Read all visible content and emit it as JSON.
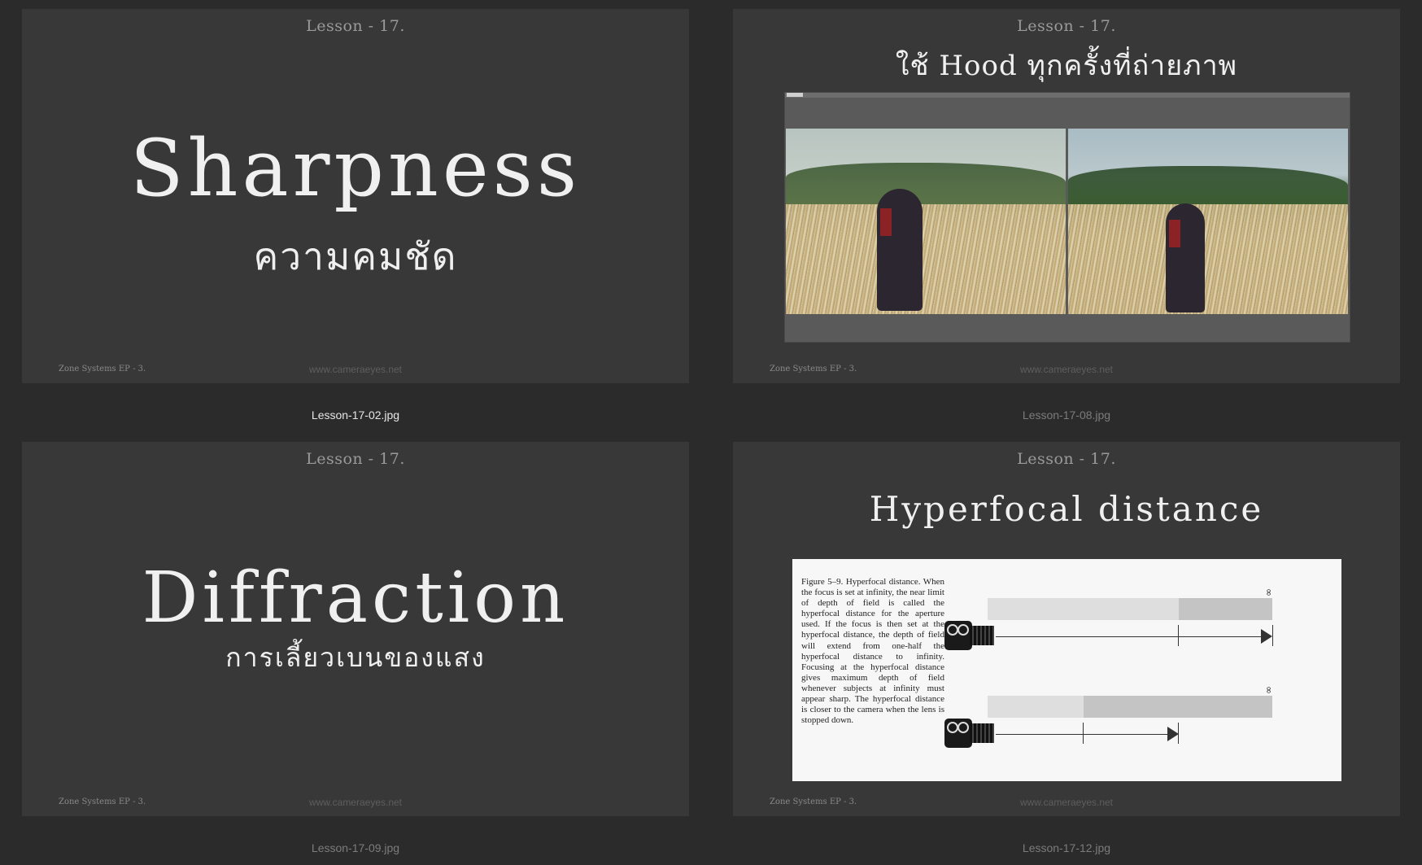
{
  "slides": [
    {
      "lesson": "Lesson - 17.",
      "title": "Sharpness",
      "subtitle": "ความคมชัด",
      "footer_left": "Zone Systems EP - 3.",
      "website": "www.cameraeyes.net",
      "filename": "Lesson-17-02.jpg",
      "selected": true
    },
    {
      "lesson": "Lesson - 17.",
      "title": "ใช้ Hood ทุกครั้งที่ถ่ายภาพ",
      "footer_left": "Zone Systems EP - 3.",
      "website": "www.cameraeyes.net",
      "filename": "Lesson-17-08.jpg",
      "selected": false
    },
    {
      "lesson": "Lesson - 17.",
      "title": "Diffraction",
      "subtitle": "การเลี้ยวเบนของแสง",
      "footer_left": "Zone Systems EP - 3.",
      "website": "www.cameraeyes.net",
      "filename": "Lesson-17-09.jpg",
      "selected": false
    },
    {
      "lesson": "Lesson - 17.",
      "title": "Hyperfocal distance",
      "figure_caption": "Figure 5–9. Hyperfocal distance. When the focus is set at infinity, the near limit of depth of field is called the hyperfocal distance for the aperture used. If the focus is then set at the hyperfocal distance, the depth of field will extend from one-half the hyperfocal distance to infinity. Focusing at the hyperfocal distance gives maximum depth of field whenever subjects at infinity must appear sharp. The hyperfocal distance is closer to the camera when the lens is stopped down.",
      "infinity_symbol": "∞",
      "footer_left": "Zone Systems EP - 3.",
      "website": "www.cameraeyes.net",
      "filename": "Lesson-17-12.jpg",
      "selected": false
    }
  ],
  "colors": {
    "background": "#2b2b2b",
    "slide": "#383838",
    "caption_selected": "#e6e6e6",
    "caption_default": "#7c7c7c"
  }
}
